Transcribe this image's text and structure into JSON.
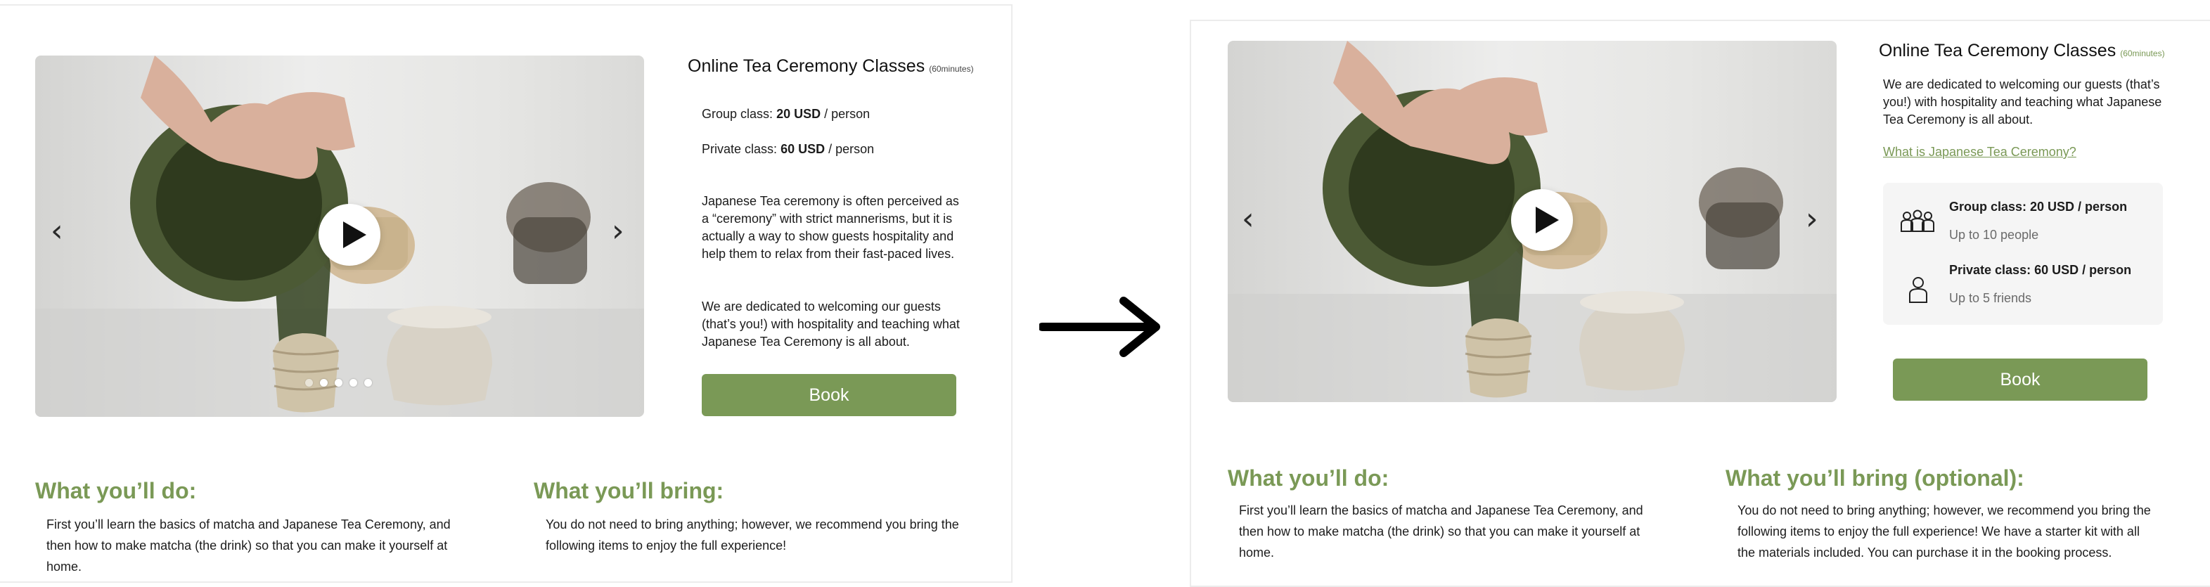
{
  "before": {
    "title": "Online Tea Ceremony Classes",
    "duration": "(60minutes)",
    "group_price_label": "Group class:",
    "group_price_value": "20 USD",
    "group_price_unit": "/ person",
    "private_price_label": "Private class:",
    "private_price_value": "60 USD",
    "private_price_unit": "/ person",
    "description_1": "Japanese Tea ceremony is often perceived as a “ceremony” with strict mannerisms, but it is actually a way to show guests hospitality and help them to relax from their fast-paced lives.",
    "description_2": "We are dedicated to welcoming our guests (that’s you!) with hospitality and teaching what Japanese Tea Ceremony is all about.",
    "book_label": "Book",
    "do_title": "What you’ll do:",
    "do_text": "First you’ll learn the basics of matcha and Japanese Tea Ceremony, and then how to make matcha (the drink) so that you can make it yourself at home.",
    "bring_title": "What you’ll bring:",
    "bring_text": "You do not need to bring anything; however, we recommend you bring the following items to enjoy the full experience!",
    "carousel_dots": 5
  },
  "after": {
    "title": "Online Tea Ceremony Classes",
    "duration": "(60minutes)",
    "description": "We are dedicated to welcoming our guests (that’s you!) with hospitality and teaching what Japanese Tea Ceremony is all about.",
    "link_text": "What is Japanese Tea Ceremony?",
    "group_title": "Group class: 20 USD / person",
    "group_sub": "Up to 10 people",
    "private_title": "Private class: 60 USD / person",
    "private_sub": "Up to 5 friends",
    "book_label": "Book",
    "do_title": "What you’ll do:",
    "do_text": "First you’ll learn the basics of matcha and Japanese Tea Ceremony, and then how to make matcha (the drink) so that you can make it yourself at home.",
    "bring_title": "What you’ll bring (optional):",
    "bring_text": "You do not need to bring anything; however, we recommend you bring the following items to enjoy the full experience! We have a starter kit with all the materials included. You can purchase it in the booking process."
  },
  "icons": {
    "play": "play-icon",
    "prev": "chevron-left-icon",
    "next": "chevron-right-icon",
    "group": "group-people-icon",
    "single": "person-icon",
    "transition": "right-arrow-icon"
  },
  "colors": {
    "accent": "#7a9956",
    "text": "#1c1c1c",
    "muted": "#6a6a6a",
    "box_bg": "#f5f5f5"
  }
}
